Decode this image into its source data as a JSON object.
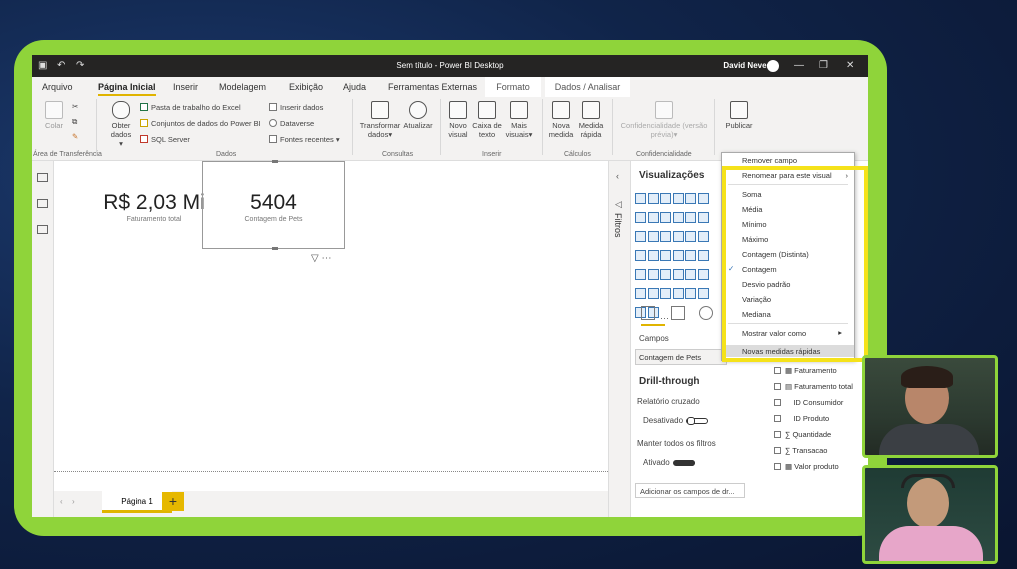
{
  "window": {
    "title": "Sem título - Power BI Desktop",
    "user": "David Neves"
  },
  "menubar": [
    "Arquivo",
    "Página Inicial",
    "Inserir",
    "Modelagem",
    "Exibição",
    "Ajuda",
    "Ferramentas Externas",
    "Formato",
    "Dados / Analisar"
  ],
  "ribbon": {
    "colar": "Colar",
    "area_transferencia": "Área de Transferência",
    "obter": "Obter",
    "dados_dd": "dados",
    "pasta_excel": "Pasta de trabalho do Excel",
    "conjuntos": "Conjuntos de dados do Power BI",
    "sql": "SQL Server",
    "inserir_dados": "Inserir dados",
    "dataverse": "Dataverse",
    "fontes": "Fontes recentes",
    "grp_dados": "Dados",
    "transformar": "Transformar",
    "transformar2": "dados",
    "atualizar": "Atualizar",
    "grp_consultas": "Consultas",
    "novo": "Novo",
    "visual": "visual",
    "caixa": "Caixa de",
    "texto": "texto",
    "mais": "Mais",
    "visuais": "visuais",
    "grp_inserir": "Inserir",
    "nova": "Nova",
    "medida": "medida",
    "medida2": "Medida",
    "rapida": "rápida",
    "grp_calculos": "Cálculos",
    "conf": "Confidencialidade (versão",
    "conf2": "prévia)",
    "grp_conf": "Confidencialidade",
    "publicar": "Publicar"
  },
  "cards": [
    {
      "value": "R$ 2,03 Mi",
      "caption": "Faturamento total"
    },
    {
      "value": "5404",
      "caption": "Contagem de Pets"
    }
  ],
  "page_tab": "Página 1",
  "add_page": "+",
  "filters_label": "Filtros",
  "visualizations": {
    "title": "Visualizações",
    "campos": "Campos",
    "field_value": "Contagem de Pets",
    "drill": "Drill-through",
    "relatorio": "Relatório cruzado",
    "desativado": "Desativado",
    "manter": "Manter todos os filtros",
    "ativado": "Ativado",
    "adicionar": "Adicionar os campos de dr..."
  },
  "context_menu": {
    "items": [
      "Remover campo",
      "Renomear para este visual",
      "Soma",
      "Média",
      "Mínimo",
      "Máximo",
      "Contagem (Distinta)",
      "Contagem",
      "Desvio padrão",
      "Variação",
      "Mediana",
      "Mostrar valor como",
      "Novas medidas rápidas"
    ],
    "checked": "Contagem"
  },
  "fields": [
    "Faturamento",
    "Faturamento total",
    "ID Consumidor",
    "ID Produto",
    "Quantidade",
    "Transacao",
    "Valor produto"
  ],
  "colors": {
    "accent": "#e0b400",
    "frame": "#8fd43a",
    "highlight": "#f5e21a"
  }
}
